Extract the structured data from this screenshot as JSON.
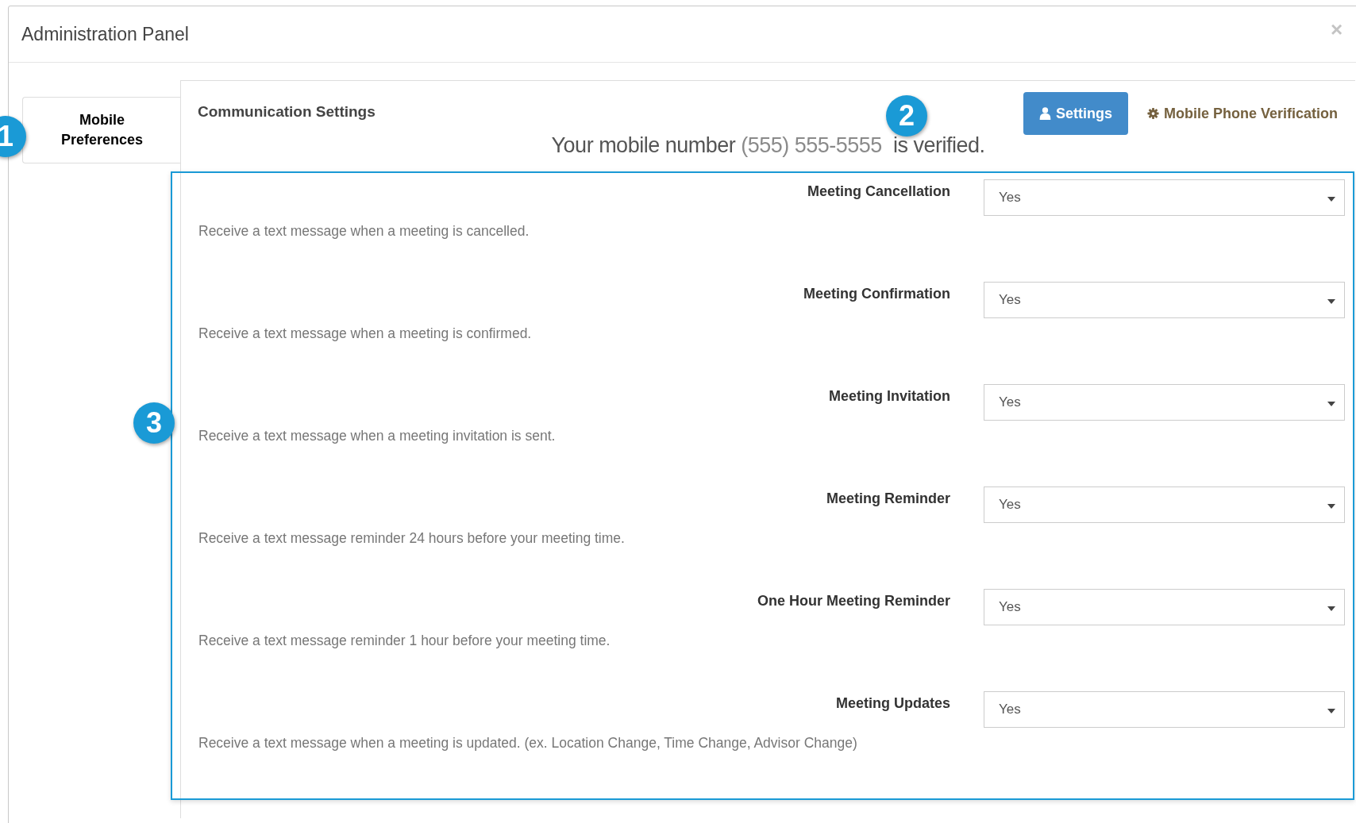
{
  "window": {
    "title": "Administration Panel",
    "close": "×"
  },
  "tabs": [
    {
      "label": "Mobile Preferences",
      "selected": true
    }
  ],
  "section": {
    "title": "Communication Settings"
  },
  "actions": [
    {
      "kind": "button",
      "label": "Settings",
      "selected": true
    },
    {
      "kind": "link",
      "label": "Mobile Phone Verification",
      "selected": false
    }
  ],
  "verification": {
    "prefix": "Your mobile number",
    "number": "(555) 555-5555",
    "suffix": "is verified."
  },
  "settings": [
    {
      "label": "Meeting Cancellation",
      "value": "Yes",
      "description": "Receive a text message when a meeting is cancelled."
    },
    {
      "label": "Meeting Confirmation",
      "value": "Yes",
      "description": "Receive a text message when a meeting is confirmed."
    },
    {
      "label": "Meeting Invitation",
      "value": "Yes",
      "description": "Receive a text message when a meeting invitation is sent."
    },
    {
      "label": "Meeting Reminder",
      "value": "Yes",
      "description": "Receive a text message reminder 24 hours before your meeting time."
    },
    {
      "label": "One Hour Meeting Reminder",
      "value": "Yes",
      "description": "Receive a text message reminder 1 hour before your meeting time."
    },
    {
      "label": "Meeting Updates",
      "value": "Yes",
      "description": "Receive a text message when a meeting is updated. (ex. Location Change, Time Change, Advisor Change)"
    }
  ],
  "callouts": [
    {
      "label": "1"
    },
    {
      "label": "2"
    },
    {
      "label": "3"
    }
  ]
}
